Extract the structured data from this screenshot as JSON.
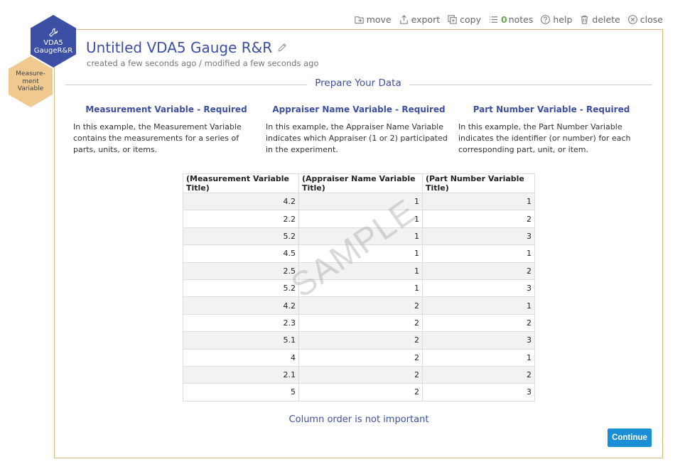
{
  "toolbar": {
    "move": "move",
    "export": "export",
    "copy": "copy",
    "notes_count": "0",
    "notes": "notes",
    "help": "help",
    "delete": "delete",
    "close": "close"
  },
  "badges": {
    "tool_line1": "VDA5",
    "tool_line2": "GaugeR&R",
    "step_line1": "Measure-",
    "step_line2": "ment",
    "step_line3": "Variable"
  },
  "header": {
    "title": "Untitled VDA5 Gauge R&R",
    "meta": "created a few seconds ago / modified a few seconds ago"
  },
  "section_title": "Prepare Your Data",
  "columns": [
    {
      "heading": "Measurement Variable - Required",
      "text": "In this example, the Measurement Variable contains the measurements for a series of parts, units, or items."
    },
    {
      "heading": "Appraiser Name Variable - Required",
      "text": "In this example, the Appraiser Name Variable indicates which Appraiser (1 or 2) participated in the experiment."
    },
    {
      "heading": "Part Number Variable - Required",
      "text": "In this example, the Part Number Variable indicates the identifier (or number) for each corresponding part, unit, or item."
    }
  ],
  "table": {
    "headers": [
      "(Measurement Variable Title)",
      "(Appraiser Name Variable Title)",
      "(Part Number Variable Title)"
    ],
    "rows": [
      [
        "4.2",
        "1",
        "1"
      ],
      [
        "2.2",
        "1",
        "2"
      ],
      [
        "5.2",
        "1",
        "3"
      ],
      [
        "4.5",
        "1",
        "1"
      ],
      [
        "2.5",
        "1",
        "2"
      ],
      [
        "5.2",
        "1",
        "3"
      ],
      [
        "4.2",
        "2",
        "1"
      ],
      [
        "2.3",
        "2",
        "2"
      ],
      [
        "5.1",
        "2",
        "3"
      ],
      [
        "4",
        "2",
        "1"
      ],
      [
        "2.1",
        "2",
        "2"
      ],
      [
        "5",
        "2",
        "3"
      ]
    ]
  },
  "watermark": "SAMPLE",
  "footer_note": "Column order is not important",
  "continue_label": "Continue",
  "colors": {
    "accent": "#3c4fa4",
    "panel_border": "#d9b778",
    "step_badge": "#efc98f",
    "button": "#1b8fd6",
    "notes_count": "#6aa84f"
  }
}
